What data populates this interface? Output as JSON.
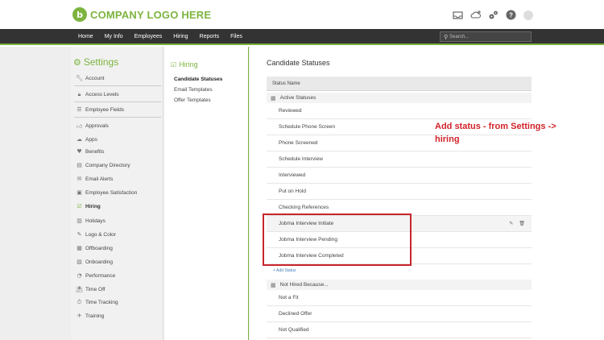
{
  "header": {
    "logo_mark": "b",
    "logo_text": "COMPANY LOGO HERE",
    "icons": [
      "inbox-icon",
      "add-cloud-icon",
      "gears-icon",
      "help-icon",
      "avatar"
    ]
  },
  "nav": {
    "items": [
      "Home",
      "My Info",
      "Employees",
      "Hiring",
      "Reports",
      "Files"
    ],
    "search_placeholder": "Search..."
  },
  "sidebar": {
    "title": "Settings",
    "items": [
      {
        "label": "Account",
        "icon": "wrench-icon"
      },
      {
        "label": "Access Levels",
        "icon": "lock-icon"
      },
      {
        "label": "Employee Fields",
        "icon": "list-icon"
      },
      {
        "label": "Approvals",
        "icon": "thumbs-up-icon"
      },
      {
        "label": "Apps",
        "icon": "cloud-icon"
      },
      {
        "label": "Benefits",
        "icon": "heart-icon"
      },
      {
        "label": "Company Directory",
        "icon": "directory-icon"
      },
      {
        "label": "Email Alerts",
        "icon": "email-icon"
      },
      {
        "label": "Employee Satisfaction",
        "icon": "satisfaction-icon"
      },
      {
        "label": "Hiring",
        "icon": "hiring-icon",
        "active": true
      },
      {
        "label": "Holidays",
        "icon": "holiday-icon"
      },
      {
        "label": "Logo & Color",
        "icon": "palette-icon"
      },
      {
        "label": "Offboarding",
        "icon": "offboarding-icon"
      },
      {
        "label": "Onboarding",
        "icon": "onboarding-icon"
      },
      {
        "label": "Performance",
        "icon": "performance-icon"
      },
      {
        "label": "Time Off",
        "icon": "time-off-icon"
      },
      {
        "label": "Time Tracking",
        "icon": "stopwatch-icon"
      },
      {
        "label": "Training",
        "icon": "training-icon"
      }
    ]
  },
  "subnav": {
    "title": "Hiring",
    "items": [
      "Candidate Statuses",
      "Email Templates",
      "Offer Templates"
    ]
  },
  "main": {
    "title": "Candidate Statuses",
    "column_header": "Status Name",
    "active_group": "Active Statuses",
    "active_rows": [
      "Reviewed",
      "Schedule Phone Screen",
      "Phone Screened",
      "Schedule Interview",
      "Interviewed",
      "Put on Hold",
      "Checking References",
      "Jobma Interview Initiate",
      "Jobma Interview Pending",
      "Jobma Interview Completed"
    ],
    "add_status": "+ Add Status",
    "inactive_group": "Not Hired Because...",
    "inactive_rows": [
      "Not a Fit",
      "Declined Offer",
      "Not Qualified"
    ],
    "row_actions": {
      "edit": "✎",
      "delete": "🗑"
    }
  },
  "annotation": {
    "line1": "Add status - from Settings ->",
    "line2": "hiring",
    "color": "#d2232a"
  },
  "colors": {
    "brand": "#7db440",
    "navbar": "#333333",
    "link": "#4a7fb5"
  }
}
